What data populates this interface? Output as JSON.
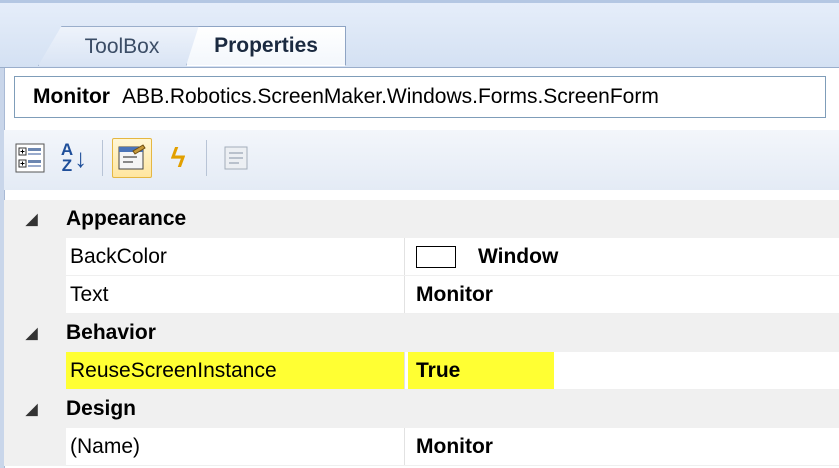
{
  "tabs": {
    "toolbox": "ToolBox",
    "properties": "Properties"
  },
  "selector": {
    "object_name": "Monitor",
    "object_type": "ABB.Robotics.ScreenMaker.Windows.Forms.ScreenForm"
  },
  "toolbar": {
    "buttons": [
      "categorized-icon",
      "alphabetical-icon",
      "properties-icon",
      "events-icon",
      "property-pages-icon"
    ],
    "az_label": "A↓Z"
  },
  "grid": {
    "expand_glyph": "◢",
    "categories": [
      {
        "name": "Appearance",
        "properties": [
          {
            "name": "BackColor",
            "value": "Window",
            "swatch": "#ffffff"
          },
          {
            "name": "Text",
            "value": "Monitor"
          }
        ]
      },
      {
        "name": "Behavior",
        "properties": [
          {
            "name": "ReuseScreenInstance",
            "value": "True",
            "highlight": "#ffff33"
          }
        ]
      },
      {
        "name": "Design",
        "properties": [
          {
            "name": "(Name)",
            "value": "Monitor"
          }
        ]
      }
    ]
  },
  "colors": {
    "highlight": "#ffff33",
    "category_bg": "#f0f0f0"
  }
}
